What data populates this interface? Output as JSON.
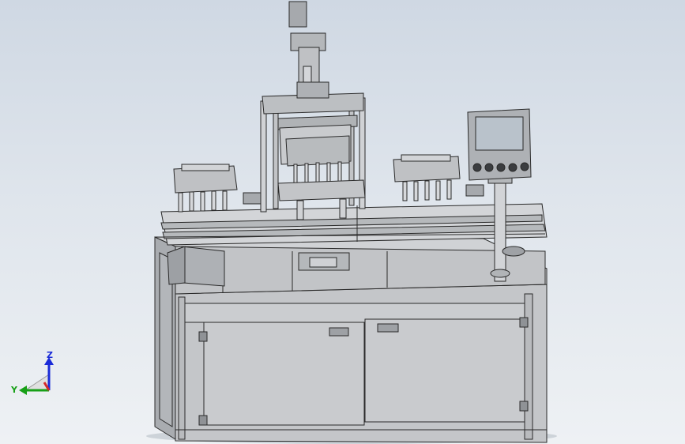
{
  "viewport": {
    "background_top": "#cfd8e3",
    "background_bottom": "#eef1f4",
    "model_fill": "#c7c9cc",
    "model_edge": "#2a2a2a"
  },
  "triad": {
    "z_label": "Z",
    "y_label": "Y",
    "z_color": "#1a2bd8",
    "y_color": "#17a017",
    "x_color": "#d42a2a"
  },
  "model": {
    "description_icon": "machine-assembly-icon",
    "hmi_screen_color": "#b9c2cb"
  }
}
